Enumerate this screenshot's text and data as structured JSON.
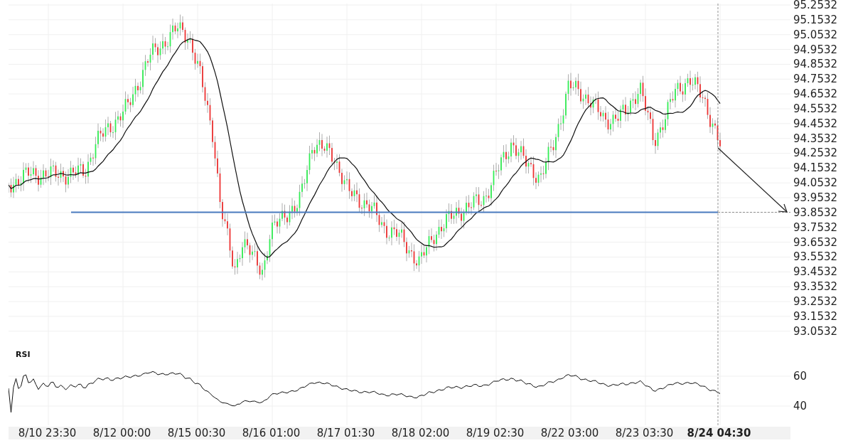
{
  "price_chart": {
    "y_axis_labels": [
      "95.2532",
      "95.1532",
      "95.0532",
      "94.9532",
      "94.8532",
      "94.7532",
      "94.6532",
      "94.5532",
      "94.4532",
      "94.3532",
      "94.2532",
      "94.1532",
      "94.0532",
      "93.9532",
      "93.8532",
      "93.7532",
      "93.6532",
      "93.5532",
      "93.4532",
      "93.3532",
      "93.2532",
      "93.1532",
      "93.0532"
    ]
  },
  "indicator": {
    "title": "RSI",
    "y_axis_labels": [
      "60",
      "40"
    ]
  },
  "x_axis": {
    "labels": [
      {
        "text": "8/10 23:30",
        "current": false
      },
      {
        "text": "8/12 00:00",
        "current": false
      },
      {
        "text": "8/15 00:30",
        "current": false
      },
      {
        "text": "8/16 01:00",
        "current": false
      },
      {
        "text": "8/17 01:30",
        "current": false
      },
      {
        "text": "8/18 02:00",
        "current": false
      },
      {
        "text": "8/19 02:30",
        "current": false
      },
      {
        "text": "8/22 03:00",
        "current": false
      },
      {
        "text": "8/23 03:30",
        "current": false
      },
      {
        "text": "8/24 04:30",
        "current": true
      }
    ]
  }
}
